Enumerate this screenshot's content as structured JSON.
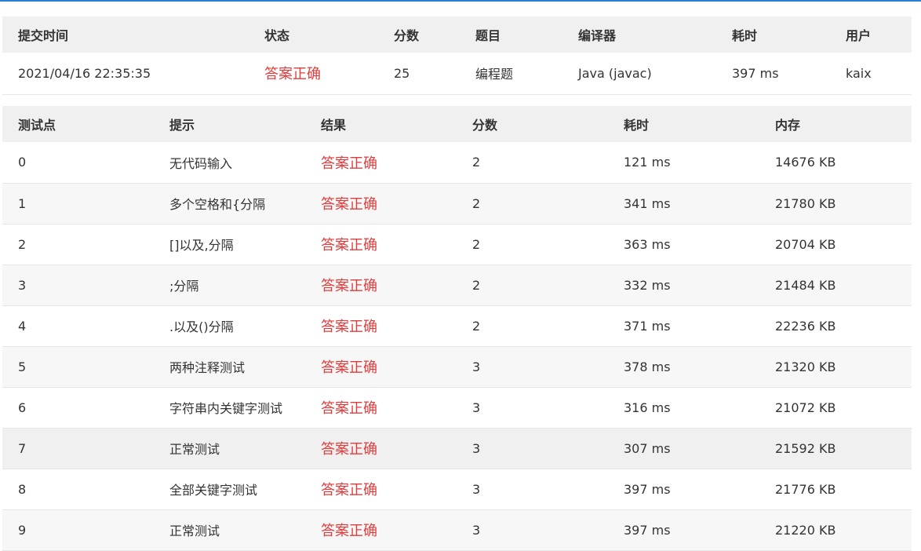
{
  "colors": {
    "accent_line": "#2a7fd4",
    "status_ok": "#e03c3c",
    "header_bg": "#f0f0f0"
  },
  "summary": {
    "headers": [
      "提交时间",
      "状态",
      "分数",
      "题目",
      "编译器",
      "耗时",
      "用户"
    ],
    "row": {
      "time": "2021/04/16 22:35:35",
      "status": "答案正确",
      "score": "25",
      "problem": "编程题",
      "compiler": "Java (javac)",
      "elapsed": "397 ms",
      "user": "kaix"
    }
  },
  "cases": {
    "headers": [
      "测试点",
      "提示",
      "结果",
      "分数",
      "耗时",
      "内存"
    ],
    "rows": [
      {
        "id": "0",
        "hint": "无代码输入",
        "result": "答案正确",
        "score": "2",
        "time": "121 ms",
        "memory": "14676 KB"
      },
      {
        "id": "1",
        "hint": "多个空格和{分隔",
        "result": "答案正确",
        "score": "2",
        "time": "341 ms",
        "memory": "21780 KB"
      },
      {
        "id": "2",
        "hint": "[]以及,分隔",
        "result": "答案正确",
        "score": "2",
        "time": "363 ms",
        "memory": "20704 KB"
      },
      {
        "id": "3",
        "hint": ";分隔",
        "result": "答案正确",
        "score": "2",
        "time": "332 ms",
        "memory": "21484 KB"
      },
      {
        "id": "4",
        "hint": ".以及()分隔",
        "result": "答案正确",
        "score": "2",
        "time": "371 ms",
        "memory": "22236 KB"
      },
      {
        "id": "5",
        "hint": "两种注释测试",
        "result": "答案正确",
        "score": "3",
        "time": "378 ms",
        "memory": "21320 KB"
      },
      {
        "id": "6",
        "hint": "字符串内关键字测试",
        "result": "答案正确",
        "score": "3",
        "time": "316 ms",
        "memory": "21072 KB"
      },
      {
        "id": "7",
        "hint": "正常测试",
        "result": "答案正确",
        "score": "3",
        "time": "307 ms",
        "memory": "21592 KB"
      },
      {
        "id": "8",
        "hint": "全部关键字测试",
        "result": "答案正确",
        "score": "3",
        "time": "397 ms",
        "memory": "21776 KB"
      },
      {
        "id": "9",
        "hint": "正常测试",
        "result": "答案正确",
        "score": "3",
        "time": "397 ms",
        "memory": "21220 KB"
      }
    ]
  }
}
